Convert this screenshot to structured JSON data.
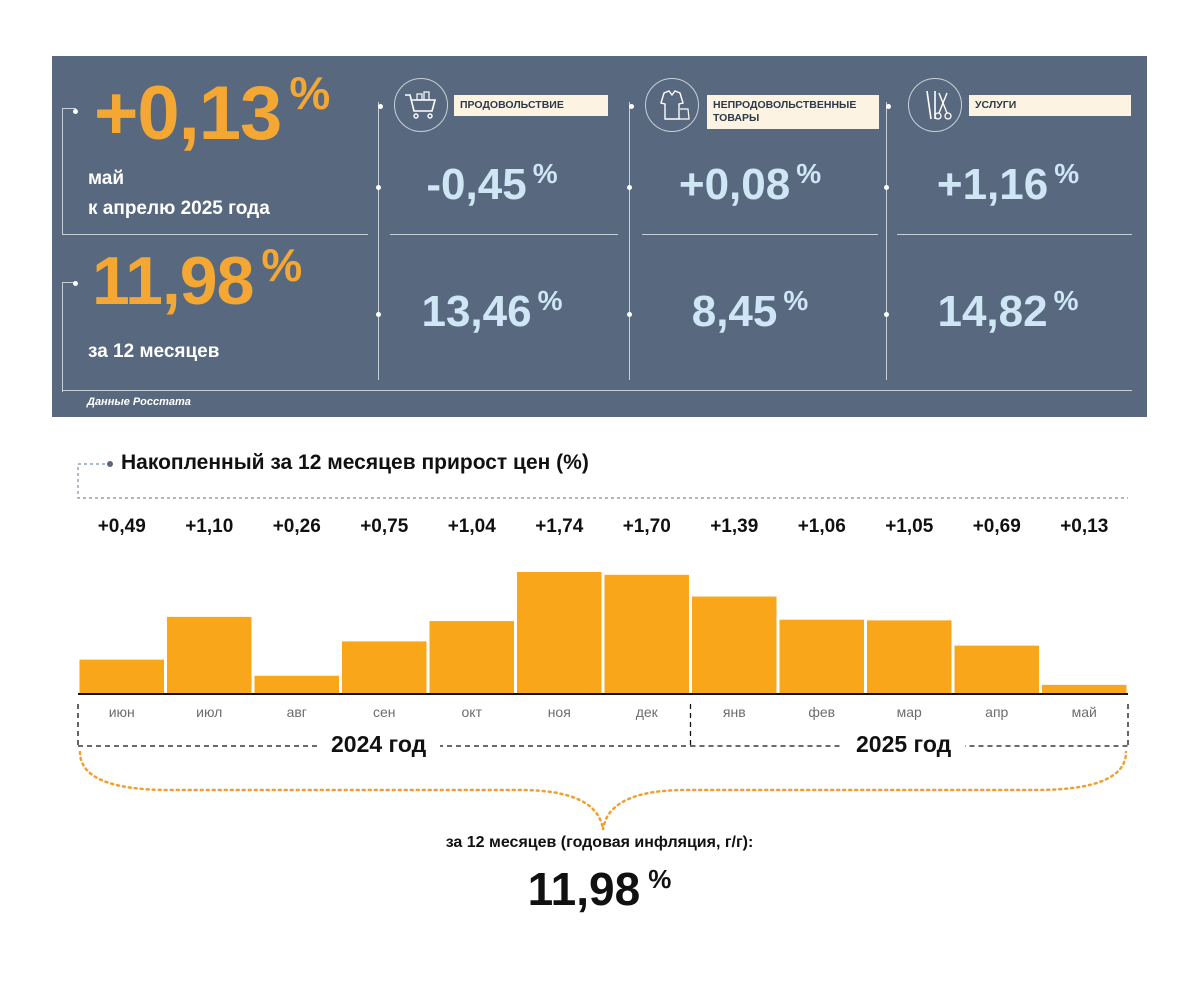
{
  "summary": {
    "monthly": {
      "value": "+0,13",
      "unit": "%",
      "line1": "май",
      "line2": "к апрелю 2025 года"
    },
    "annual": {
      "value": "11,98",
      "unit": "%",
      "caption": "за 12 месяцев"
    },
    "source": "Данные Росстата",
    "categories": [
      {
        "label": "продовольствие",
        "monthly": "-0,45",
        "annual": "13,46",
        "unit": "%",
        "icon": "shopping-cart-icon"
      },
      {
        "label": "непродовольственные товары",
        "monthly": "+0,08",
        "annual": "8,45",
        "unit": "%",
        "icon": "clothes-icon"
      },
      {
        "label": "услуги",
        "monthly": "+1,16",
        "annual": "14,82",
        "unit": "%",
        "icon": "tools-icon"
      }
    ]
  },
  "colors": {
    "panel": "#58697f",
    "accent_orange": "#f5a733",
    "value_blue": "#cfe6f5",
    "bar": "#faa61a"
  },
  "chart_title": "Накопленный за 12 месяцев прирост цен (%)",
  "chart_data": {
    "type": "bar",
    "categories": [
      "июн",
      "июл",
      "авг",
      "сен",
      "окт",
      "ноя",
      "дек",
      "янв",
      "фев",
      "мар",
      "апр",
      "май"
    ],
    "values": [
      0.49,
      1.1,
      0.26,
      0.75,
      1.04,
      1.74,
      1.7,
      1.39,
      1.06,
      1.05,
      0.69,
      0.13
    ],
    "value_labels": [
      "+0,49",
      "+1,10",
      "+0,26",
      "+0,75",
      "+1,04",
      "+1,74",
      "+1,70",
      "+1,39",
      "+1,06",
      "+1,05",
      "+0,69",
      "+0,13"
    ],
    "groups": [
      {
        "label": "2024 год",
        "count": 7
      },
      {
        "label": "2025 год",
        "count": 5
      }
    ],
    "ylim": [
      0,
      1.74
    ],
    "grid": false
  },
  "annual_summary": {
    "caption": "за 12 месяцев (годовая инфляция, г/г):",
    "value": "11,98",
    "unit": "%"
  }
}
